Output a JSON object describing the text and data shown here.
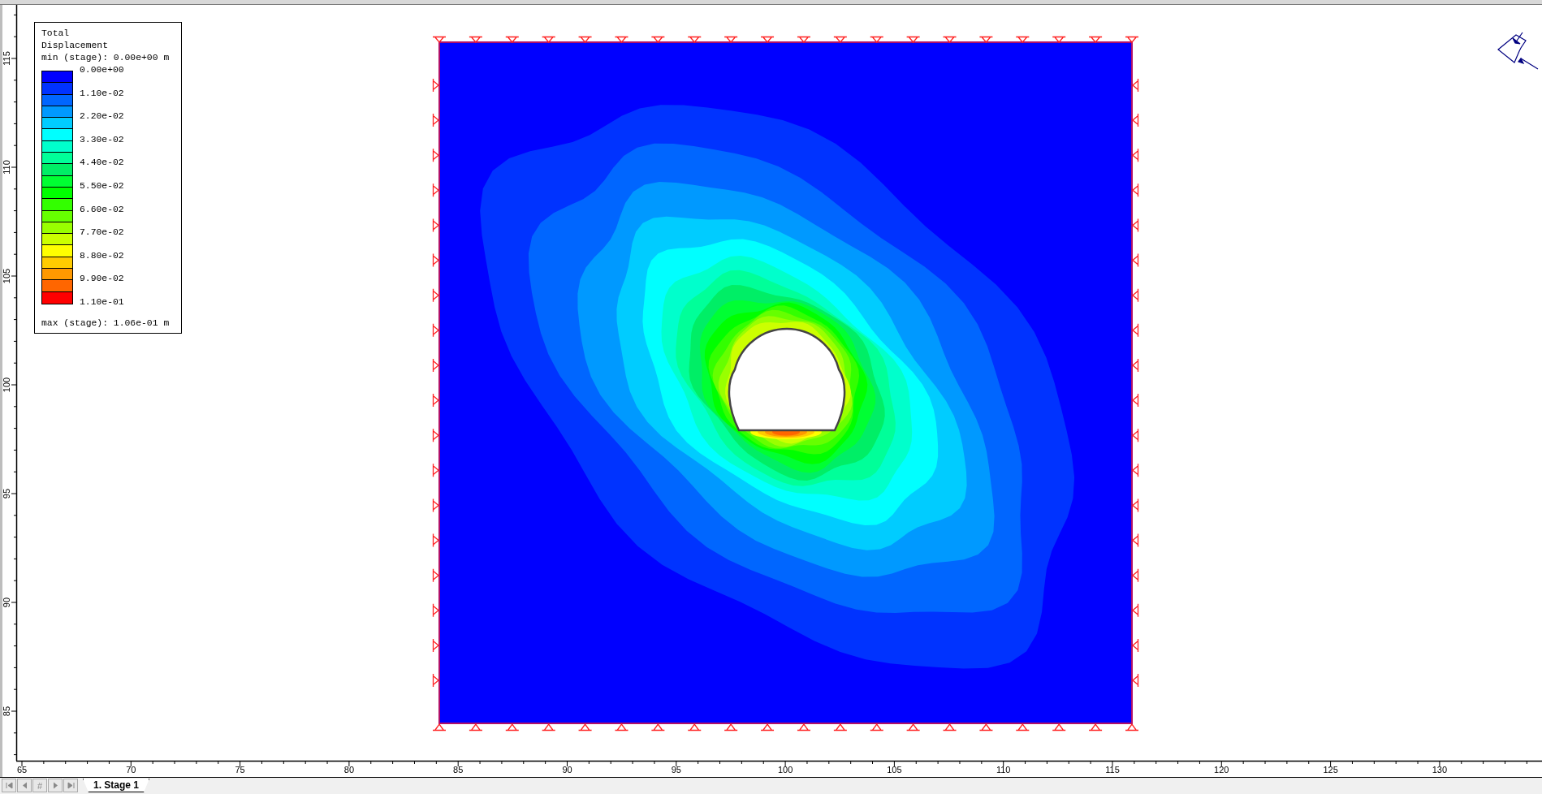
{
  "legend": {
    "title_lines": [
      "Total",
      "Displacement"
    ],
    "min_text": "min (stage): 0.00e+00 m",
    "max_text": "max (stage): 1.06e-01 m",
    "bands": [
      {
        "color": "#0000ff"
      },
      {
        "color": "#0033ff"
      },
      {
        "color": "#0066ff"
      },
      {
        "color": "#0099ff"
      },
      {
        "color": "#00ccff"
      },
      {
        "color": "#00ffff"
      },
      {
        "color": "#00ffcc"
      },
      {
        "color": "#00ff99"
      },
      {
        "color": "#00ee66"
      },
      {
        "color": "#00ff33"
      },
      {
        "color": "#00ff00"
      },
      {
        "color": "#33ff00"
      },
      {
        "color": "#66ff00"
      },
      {
        "color": "#99ff00"
      },
      {
        "color": "#ccff00"
      },
      {
        "color": "#ffff00"
      },
      {
        "color": "#ffcc00"
      },
      {
        "color": "#ff9900"
      },
      {
        "color": "#ff6600"
      },
      {
        "color": "#ff0000"
      }
    ],
    "labels": [
      "0.00e+00",
      "1.10e-02",
      "2.20e-02",
      "3.30e-02",
      "4.40e-02",
      "5.50e-02",
      "6.60e-02",
      "7.70e-02",
      "8.80e-02",
      "9.90e-02",
      "1.10e-01"
    ]
  },
  "y_axis": {
    "labels": [
      "85",
      "90",
      "95",
      "100",
      "105",
      "110",
      "115"
    ]
  },
  "x_axis": {
    "labels": [
      "65",
      "70",
      "75",
      "80",
      "85",
      "90",
      "95",
      "100",
      "105",
      "110",
      "115",
      "120",
      "125",
      "130"
    ]
  },
  "navigation": {
    "page_button": "#"
  },
  "tabs": [
    {
      "label": "1. Stage 1",
      "selected": true
    }
  ]
}
